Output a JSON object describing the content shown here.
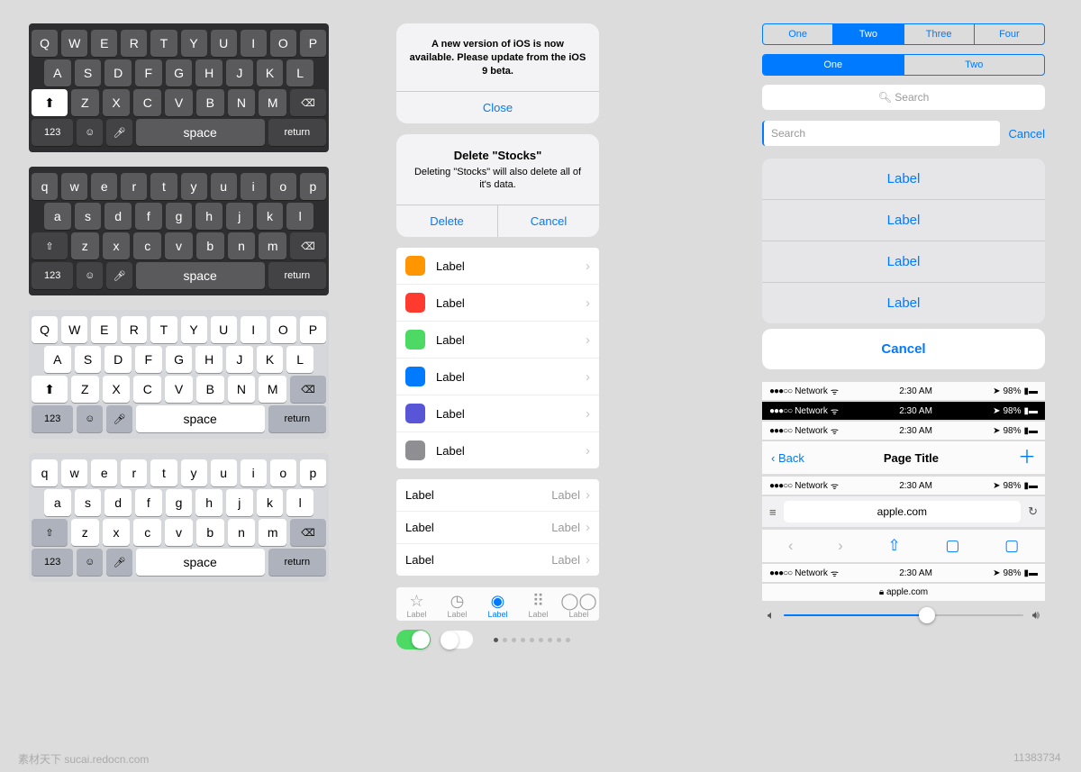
{
  "keyboards": {
    "rows_upper": [
      [
        "Q",
        "W",
        "E",
        "R",
        "T",
        "Y",
        "U",
        "I",
        "O",
        "P"
      ],
      [
        "A",
        "S",
        "D",
        "F",
        "G",
        "H",
        "J",
        "K",
        "L"
      ],
      [
        "Z",
        "X",
        "C",
        "V",
        "B",
        "N",
        "M"
      ]
    ],
    "rows_lower": [
      [
        "q",
        "w",
        "e",
        "r",
        "t",
        "y",
        "u",
        "i",
        "o",
        "p"
      ],
      [
        "a",
        "s",
        "d",
        "f",
        "g",
        "h",
        "j",
        "k",
        "l"
      ],
      [
        "z",
        "x",
        "c",
        "v",
        "b",
        "n",
        "m"
      ]
    ],
    "num_key": "123",
    "space": "space",
    "return": "return"
  },
  "alert1": {
    "msg": "A new version of iOS is now available. Please update from the iOS 9 beta.",
    "close": "Close"
  },
  "alert2": {
    "title": "Delete \"Stocks\"",
    "msg": "Deleting \"Stocks\" will also delete all of it's data.",
    "delete": "Delete",
    "cancel": "Cancel"
  },
  "color_list": [
    {
      "color": "#ff9500",
      "label": "Label"
    },
    {
      "color": "#ff3b30",
      "label": "Label"
    },
    {
      "color": "#4cd964",
      "label": "Label"
    },
    {
      "color": "#007aff",
      "label": "Label"
    },
    {
      "color": "#5856d6",
      "label": "Label"
    },
    {
      "color": "#8e8e93",
      "label": "Label"
    }
  ],
  "detail_list": [
    {
      "label": "Label",
      "detail": "Label"
    },
    {
      "label": "Label",
      "detail": "Label"
    },
    {
      "label": "Label",
      "detail": "Label"
    }
  ],
  "tabs": [
    "Label",
    "Label",
    "Label",
    "Label",
    "Label"
  ],
  "seg4": [
    "One",
    "Two",
    "Three",
    "Four"
  ],
  "seg2": [
    "One",
    "Two"
  ],
  "search_placeholder": "Search",
  "cancel": "Cancel",
  "sheet_labels": [
    "Label",
    "Label",
    "Label",
    "Label"
  ],
  "sheet_cancel": "Cancel",
  "status": {
    "carrier": "Network",
    "time": "2:30 AM",
    "battery": "98%"
  },
  "nav": {
    "back": "Back",
    "title": "Page Title"
  },
  "url": "apple.com",
  "secure_url": "apple.com",
  "watermark_left": "素材天下 sucai.redocn.com",
  "watermark_right": "11383734"
}
